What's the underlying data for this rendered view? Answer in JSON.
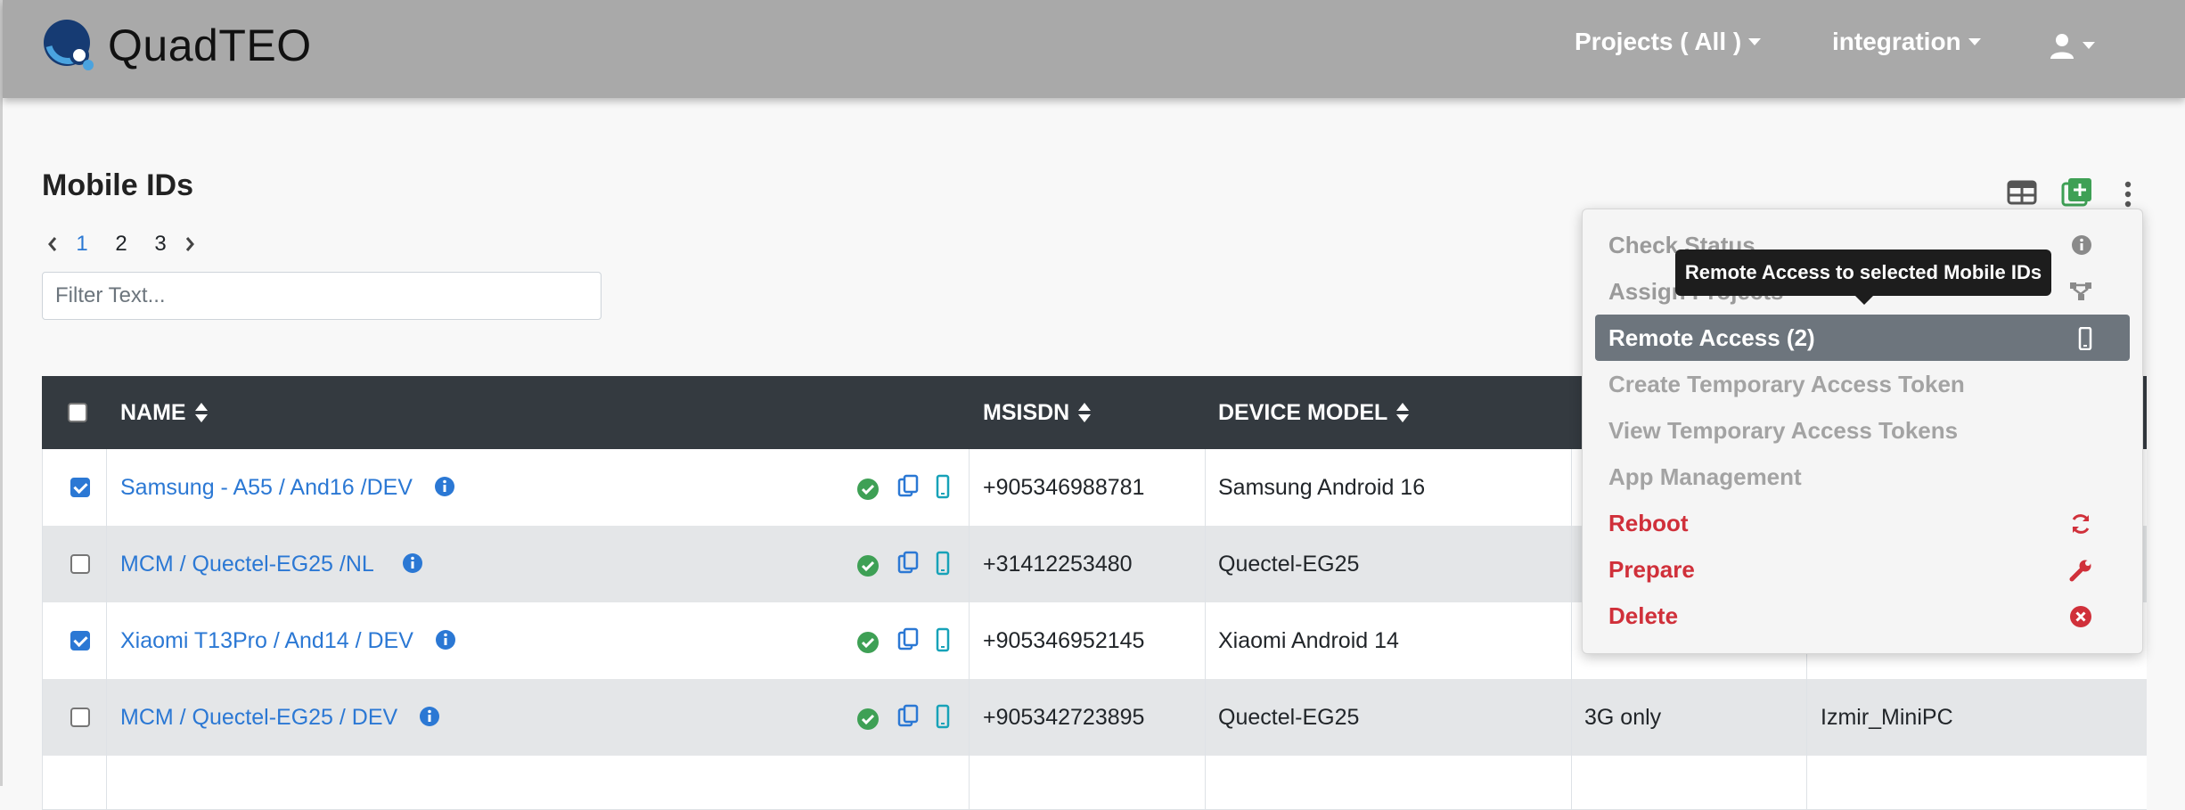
{
  "app": {
    "brand": "QuadTEO"
  },
  "navbar": {
    "projects_label": "Projects ( All )",
    "env_label": "integration"
  },
  "page": {
    "title": "Mobile IDs"
  },
  "pager": {
    "pages": [
      "1",
      "2",
      "3"
    ],
    "active": "1"
  },
  "filter": {
    "placeholder": "Filter Text...",
    "value": ""
  },
  "table": {
    "headers": {
      "name": "NAME",
      "msisdn": "MSISDN",
      "device_model": "DEVICE MODEL"
    },
    "rows": [
      {
        "checked": true,
        "name": "Samsung - A55 / And16 /DEV",
        "msisdn": "+905346988781",
        "model": "Samsung Android 16",
        "network": "",
        "location": ""
      },
      {
        "checked": false,
        "name": "MCM / Quectel-EG25 /NL",
        "msisdn": "+31412253480",
        "model": "Quectel-EG25",
        "network": "",
        "location": ""
      },
      {
        "checked": true,
        "name": "Xiaomi T13Pro / And14 / DEV",
        "msisdn": "+905346952145",
        "model": "Xiaomi Android 14",
        "network": "",
        "location": ""
      },
      {
        "checked": false,
        "name": "MCM / Quectel-EG25 / DEV",
        "msisdn": "+905342723895",
        "model": "Quectel-EG25",
        "network": "3G only",
        "location": "Izmir_MiniPC"
      }
    ]
  },
  "dropdown": {
    "items": [
      {
        "label": "Check Status",
        "icon": "info-icon"
      },
      {
        "label": "Assign Projects",
        "icon": "hierarchy-icon"
      },
      {
        "label": "Remote Access (2)",
        "icon": "mobile-icon"
      },
      {
        "label": "Create Temporary Access Token",
        "icon": ""
      },
      {
        "label": "View Temporary Access Tokens",
        "icon": ""
      },
      {
        "label": "App Management",
        "icon": ""
      },
      {
        "label": "Reboot",
        "icon": "sync-icon"
      },
      {
        "label": "Prepare",
        "icon": "wrench-icon"
      },
      {
        "label": "Delete",
        "icon": "times-circle-icon"
      }
    ]
  },
  "tooltip": {
    "text": "Remote Access to selected Mobile IDs"
  },
  "colors": {
    "navbar": "#a9a9a9",
    "link": "#2b78d4",
    "danger": "#d0303a",
    "success": "#3ea055",
    "header": "#343a40"
  }
}
